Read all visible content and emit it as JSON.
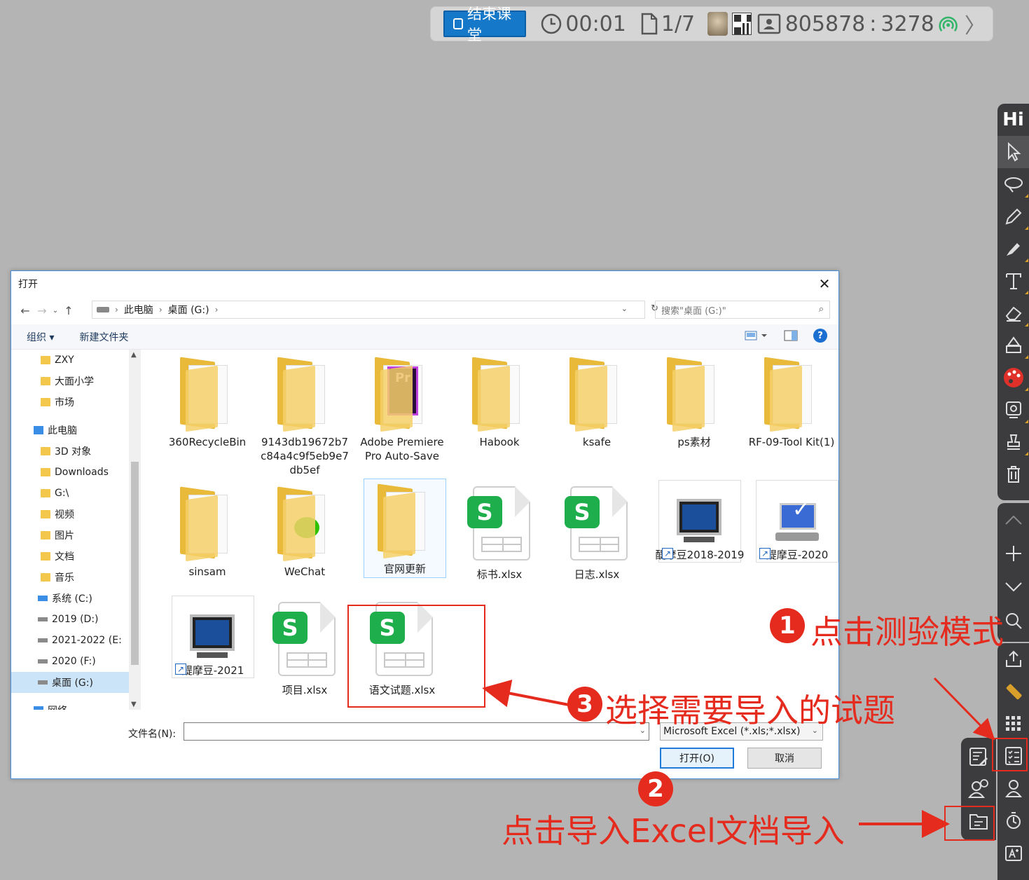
{
  "topbar": {
    "end_class": "结束课堂",
    "timer": "00:01",
    "pages": "1/7",
    "room_code": "805878",
    "room_sep": ":",
    "room_num": "3278"
  },
  "toolbar": {
    "hi_label": "Hi"
  },
  "dialog": {
    "title": "打开",
    "address": {
      "root": "此电脑",
      "folder": "桌面 (G:)"
    },
    "search_placeholder": "搜索\"桌面 (G:)\"",
    "cmd": {
      "organize": "组织 ▾",
      "new_folder": "新建文件夹"
    },
    "nav_items": [
      {
        "label": "ZXY"
      },
      {
        "label": "大面小学"
      },
      {
        "label": "市场"
      },
      {
        "label": "此电脑"
      },
      {
        "label": "3D 对象"
      },
      {
        "label": "Downloads"
      },
      {
        "label": "G:\\"
      },
      {
        "label": "视频"
      },
      {
        "label": "图片"
      },
      {
        "label": "文档"
      },
      {
        "label": "音乐"
      },
      {
        "label": "系统 (C:)"
      },
      {
        "label": "2019 (D:)"
      },
      {
        "label": "2021-2022 (E:"
      },
      {
        "label": "2020 (F:)"
      },
      {
        "label": "桌面 (G:)"
      },
      {
        "label": "网络"
      }
    ],
    "files": [
      {
        "name": "360RecycleBin"
      },
      {
        "name": "9143db19672b7c84a4c9f5eb9e7db5ef"
      },
      {
        "name": "Adobe Premiere Pro Auto-Save"
      },
      {
        "name": "Habook"
      },
      {
        "name": "ksafe"
      },
      {
        "name": "ps素材"
      },
      {
        "name": "RF-09-Tool Kit(1)"
      },
      {
        "name": "sinsam"
      },
      {
        "name": "WeChat"
      },
      {
        "name": "官网更新"
      },
      {
        "name": "标书.xlsx"
      },
      {
        "name": "日志.xlsx"
      },
      {
        "name": "醍摩豆2018-2019"
      },
      {
        "name": "醍摩豆-2020"
      },
      {
        "name": "醍摩豆-2021"
      },
      {
        "name": "项目.xlsx"
      },
      {
        "name": "语文试题.xlsx"
      }
    ],
    "filename_label": "文件名(N):",
    "filename_value": "",
    "filetype": "Microsoft Excel (*.xls;*.xlsx)",
    "open_btn": "打开(O)",
    "cancel_btn": "取消"
  },
  "annotations": {
    "step1_num": "1",
    "step1": "点击测验模式",
    "step2_num": "2",
    "step2": "点击导入Excel文档导入",
    "step3_num": "3",
    "step3": "选择需要导入的试题"
  },
  "colors": {
    "annotation": "#e52a1e",
    "accent": "#1578c8",
    "toolbar": "#3c3c3e"
  }
}
